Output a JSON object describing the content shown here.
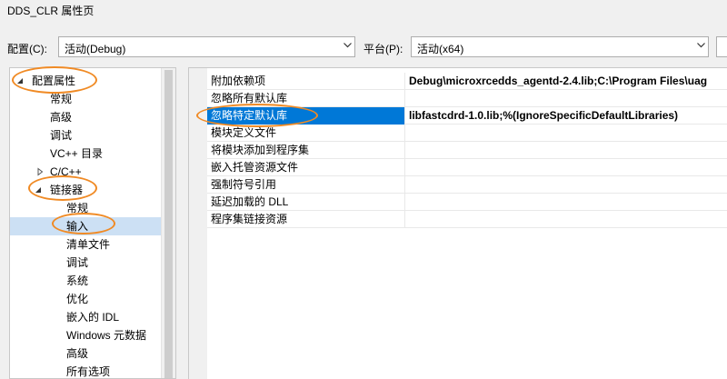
{
  "window": {
    "title": "DDS_CLR 属性页"
  },
  "toolbar": {
    "config_label": "配置(C):",
    "config_value": "活动(Debug)",
    "platform_label": "平台(P):",
    "platform_value": "活动(x64)"
  },
  "tree": {
    "root": "配置属性",
    "items": [
      "常规",
      "高级",
      "调试",
      "VC++ 目录",
      "C/C++"
    ],
    "linker": "链接器",
    "linker_children": [
      "常规",
      "输入",
      "清单文件",
      "调试",
      "系统",
      "优化",
      "嵌入的 IDL",
      "Windows 元数据",
      "高级",
      "所有选项"
    ]
  },
  "grid": {
    "rows": [
      {
        "prop": "附加依赖项",
        "value": "Debug\\microxrcedds_agentd-2.4.lib;C:\\Program Files\\uag"
      },
      {
        "prop": "忽略所有默认库",
        "value": ""
      },
      {
        "prop": "忽略特定默认库",
        "value": "libfastcdrd-1.0.lib;%(IgnoreSpecificDefaultLibraries)"
      },
      {
        "prop": "模块定义文件",
        "value": ""
      },
      {
        "prop": "将模块添加到程序集",
        "value": ""
      },
      {
        "prop": "嵌入托管资源文件",
        "value": ""
      },
      {
        "prop": "强制符号引用",
        "value": ""
      },
      {
        "prop": "延迟加载的 DLL",
        "value": ""
      },
      {
        "prop": "程序集链接资源",
        "value": ""
      }
    ],
    "selected_index": 2
  },
  "colors": {
    "annotation": "#f08a24",
    "selection": "#0078d7",
    "tree_selection": "#cce0f4"
  }
}
